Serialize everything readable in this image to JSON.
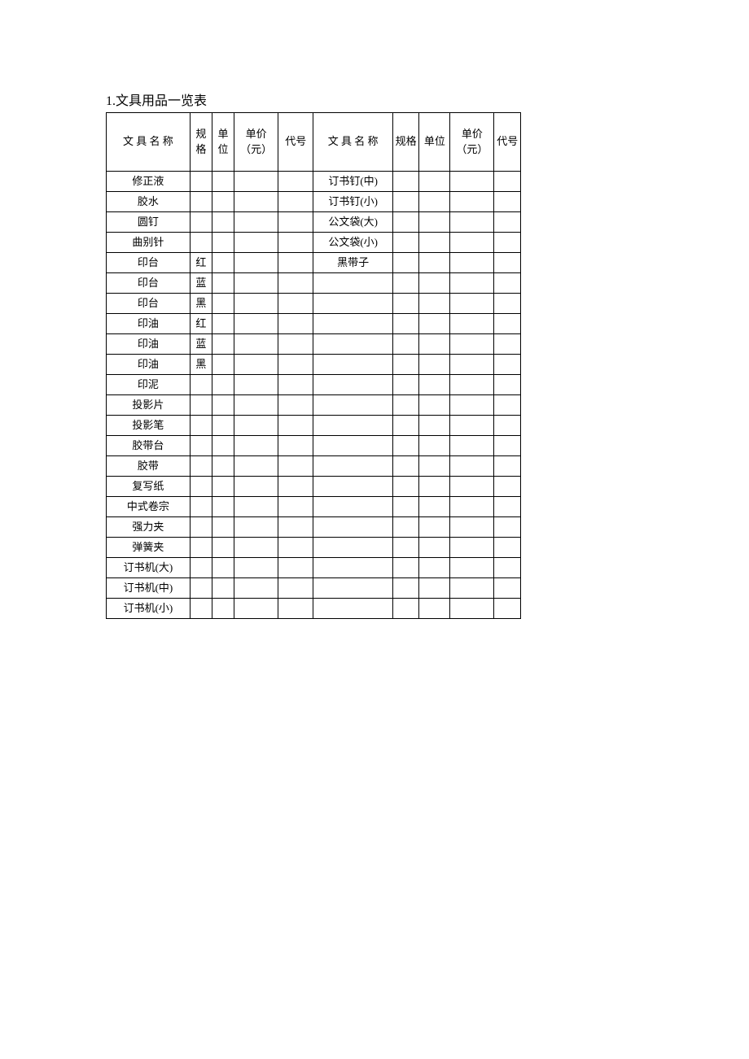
{
  "title": "1.文具用品一览表",
  "chart_data": {
    "type": "table",
    "headers_left": [
      "文 具 名 称",
      "规格",
      "单位",
      "单价（元）",
      "代号"
    ],
    "headers_right": [
      "文 具 名 称",
      "规格",
      "单位",
      "单价（元）",
      "代号"
    ],
    "rows": [
      {
        "left_name": "修正液",
        "left_spec": "",
        "left_unit": "",
        "left_price": "",
        "left_code": "",
        "right_name": "订书钉(中)",
        "right_spec": "",
        "right_unit": "",
        "right_price": "",
        "right_code": ""
      },
      {
        "left_name": "胶水",
        "left_spec": "",
        "left_unit": "",
        "left_price": "",
        "left_code": "",
        "right_name": "订书钉(小)",
        "right_spec": "",
        "right_unit": "",
        "right_price": "",
        "right_code": ""
      },
      {
        "left_name": "圆钉",
        "left_spec": "",
        "left_unit": "",
        "left_price": "",
        "left_code": "",
        "right_name": "公文袋(大)",
        "right_spec": "",
        "right_unit": "",
        "right_price": "",
        "right_code": ""
      },
      {
        "left_name": "曲别针",
        "left_spec": "",
        "left_unit": "",
        "left_price": "",
        "left_code": "",
        "right_name": "公文袋(小)",
        "right_spec": "",
        "right_unit": "",
        "right_price": "",
        "right_code": ""
      },
      {
        "left_name": "印台",
        "left_spec": "红",
        "left_unit": "",
        "left_price": "",
        "left_code": "",
        "right_name": "黑带子",
        "right_spec": "",
        "right_unit": "",
        "right_price": "",
        "right_code": ""
      },
      {
        "left_name": "印台",
        "left_spec": "蓝",
        "left_unit": "",
        "left_price": "",
        "left_code": "",
        "right_name": "",
        "right_spec": "",
        "right_unit": "",
        "right_price": "",
        "right_code": ""
      },
      {
        "left_name": "印台",
        "left_spec": "黑",
        "left_unit": "",
        "left_price": "",
        "left_code": "",
        "right_name": "",
        "right_spec": "",
        "right_unit": "",
        "right_price": "",
        "right_code": ""
      },
      {
        "left_name": "印油",
        "left_spec": "红",
        "left_unit": "",
        "left_price": "",
        "left_code": "",
        "right_name": "",
        "right_spec": "",
        "right_unit": "",
        "right_price": "",
        "right_code": ""
      },
      {
        "left_name": "印油",
        "left_spec": "蓝",
        "left_unit": "",
        "left_price": "",
        "left_code": "",
        "right_name": "",
        "right_spec": "",
        "right_unit": "",
        "right_price": "",
        "right_code": ""
      },
      {
        "left_name": "印油",
        "left_spec": "黑",
        "left_unit": "",
        "left_price": "",
        "left_code": "",
        "right_name": "",
        "right_spec": "",
        "right_unit": "",
        "right_price": "",
        "right_code": ""
      },
      {
        "left_name": "印泥",
        "left_spec": "",
        "left_unit": "",
        "left_price": "",
        "left_code": "",
        "right_name": "",
        "right_spec": "",
        "right_unit": "",
        "right_price": "",
        "right_code": ""
      },
      {
        "left_name": "投影片",
        "left_spec": "",
        "left_unit": "",
        "left_price": "",
        "left_code": "",
        "right_name": "",
        "right_spec": "",
        "right_unit": "",
        "right_price": "",
        "right_code": ""
      },
      {
        "left_name": "投影笔",
        "left_spec": "",
        "left_unit": "",
        "left_price": "",
        "left_code": "",
        "right_name": "",
        "right_spec": "",
        "right_unit": "",
        "right_price": "",
        "right_code": ""
      },
      {
        "left_name": "胶带台",
        "left_spec": "",
        "left_unit": "",
        "left_price": "",
        "left_code": "",
        "right_name": "",
        "right_spec": "",
        "right_unit": "",
        "right_price": "",
        "right_code": ""
      },
      {
        "left_name": "胶带",
        "left_spec": "",
        "left_unit": "",
        "left_price": "",
        "left_code": "",
        "right_name": "",
        "right_spec": "",
        "right_unit": "",
        "right_price": "",
        "right_code": ""
      },
      {
        "left_name": "复写纸",
        "left_spec": "",
        "left_unit": "",
        "left_price": "",
        "left_code": "",
        "right_name": "",
        "right_spec": "",
        "right_unit": "",
        "right_price": "",
        "right_code": ""
      },
      {
        "left_name": "中式卷宗",
        "left_spec": "",
        "left_unit": "",
        "left_price": "",
        "left_code": "",
        "right_name": "",
        "right_spec": "",
        "right_unit": "",
        "right_price": "",
        "right_code": ""
      },
      {
        "left_name": "强力夹",
        "left_spec": "",
        "left_unit": "",
        "left_price": "",
        "left_code": "",
        "right_name": "",
        "right_spec": "",
        "right_unit": "",
        "right_price": "",
        "right_code": ""
      },
      {
        "left_name": "弹簧夹",
        "left_spec": "",
        "left_unit": "",
        "left_price": "",
        "left_code": "",
        "right_name": "",
        "right_spec": "",
        "right_unit": "",
        "right_price": "",
        "right_code": ""
      },
      {
        "left_name": "订书机(大)",
        "left_spec": "",
        "left_unit": "",
        "left_price": "",
        "left_code": "",
        "right_name": "",
        "right_spec": "",
        "right_unit": "",
        "right_price": "",
        "right_code": ""
      },
      {
        "left_name": "订书机(中)",
        "left_spec": "",
        "left_unit": "",
        "left_price": "",
        "left_code": "",
        "right_name": "",
        "right_spec": "",
        "right_unit": "",
        "right_price": "",
        "right_code": ""
      },
      {
        "left_name": "订书机(小)",
        "left_spec": "",
        "left_unit": "",
        "left_price": "",
        "left_code": "",
        "right_name": "",
        "right_spec": "",
        "right_unit": "",
        "right_price": "",
        "right_code": ""
      }
    ]
  }
}
